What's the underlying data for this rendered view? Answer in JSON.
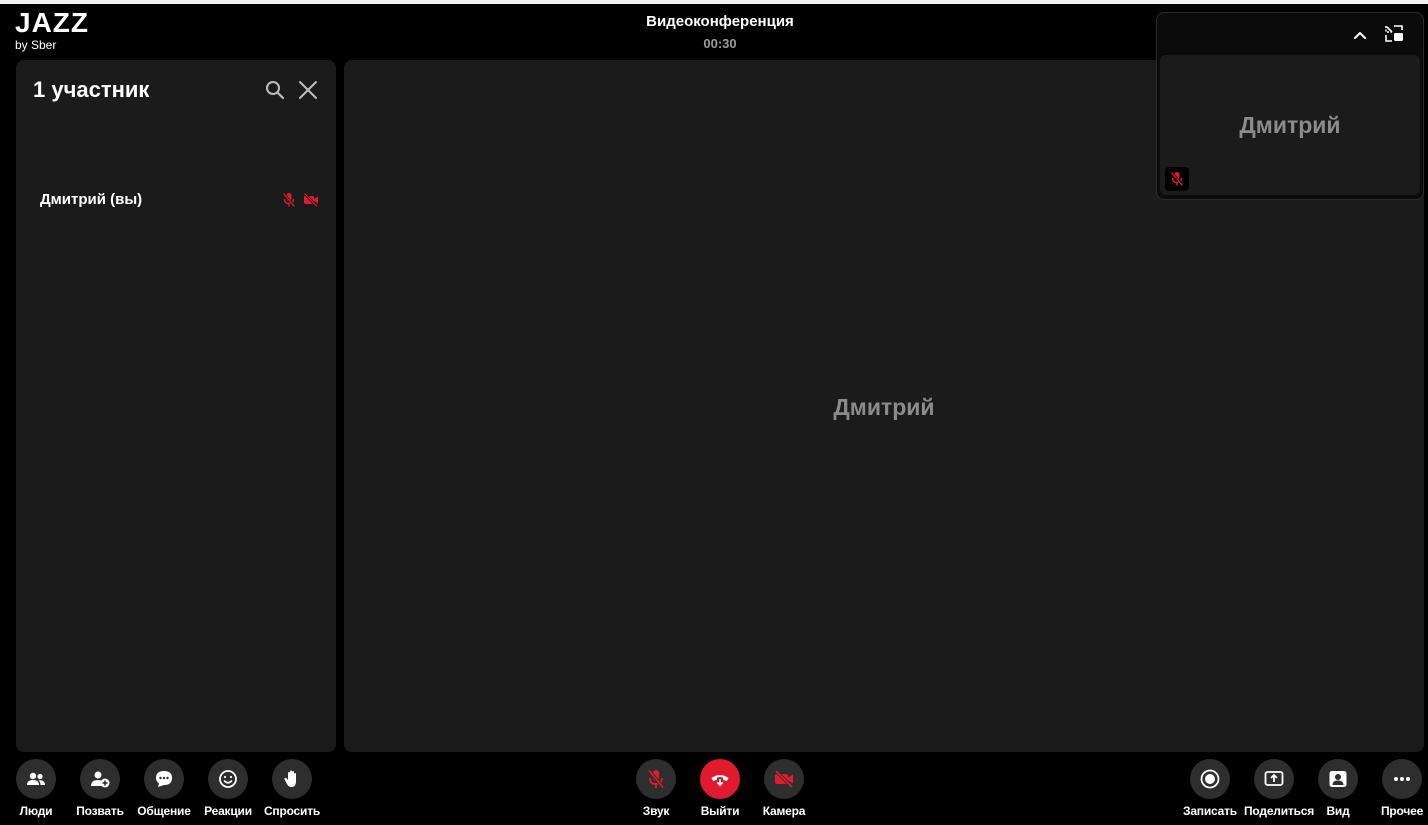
{
  "app": {
    "brand": "JAZZ",
    "brand_sub": "by Sber"
  },
  "meeting": {
    "title": "Видеоконференция",
    "timer": "00:30"
  },
  "participants_panel": {
    "title": "1 участник",
    "search_icon": "search-icon",
    "close_icon": "close-icon",
    "participants": [
      {
        "name": "Дмитрий (вы)",
        "mic": "mic-off-icon",
        "camera": "camera-off-icon"
      }
    ]
  },
  "stage": {
    "participant_name": "Дмитрий"
  },
  "self_view": {
    "participant_name": "Дмитрий",
    "collapse_icon": "chevron-up-icon",
    "swap_icon": "swap-view-icon"
  },
  "controls": {
    "left": [
      {
        "label": "Люди",
        "icon": "people-icon"
      },
      {
        "label": "Позвать",
        "icon": "add-person-icon"
      },
      {
        "label": "Общение",
        "icon": "chat-icon"
      },
      {
        "label": "Реакции",
        "icon": "smile-icon"
      },
      {
        "label": "Спросить",
        "icon": "raise-hand-icon"
      }
    ],
    "center": [
      {
        "label": "Звук",
        "icon": "mic-off-icon"
      },
      {
        "label": "Выйти",
        "icon": "hang-up-icon"
      },
      {
        "label": "Камера",
        "icon": "camera-off-icon"
      }
    ],
    "right": [
      {
        "label": "Записать",
        "icon": "record-icon"
      },
      {
        "label": "Поделиться",
        "icon": "share-screen-icon"
      },
      {
        "label": "Вид",
        "icon": "view-icon"
      },
      {
        "label": "Прочее",
        "icon": "more-icon"
      }
    ]
  },
  "colors": {
    "background": "#000000",
    "panel": "#1b1b1b",
    "button": "#2e2e2e",
    "danger": "#e11b2f",
    "muted_text": "#8b8b8b"
  }
}
